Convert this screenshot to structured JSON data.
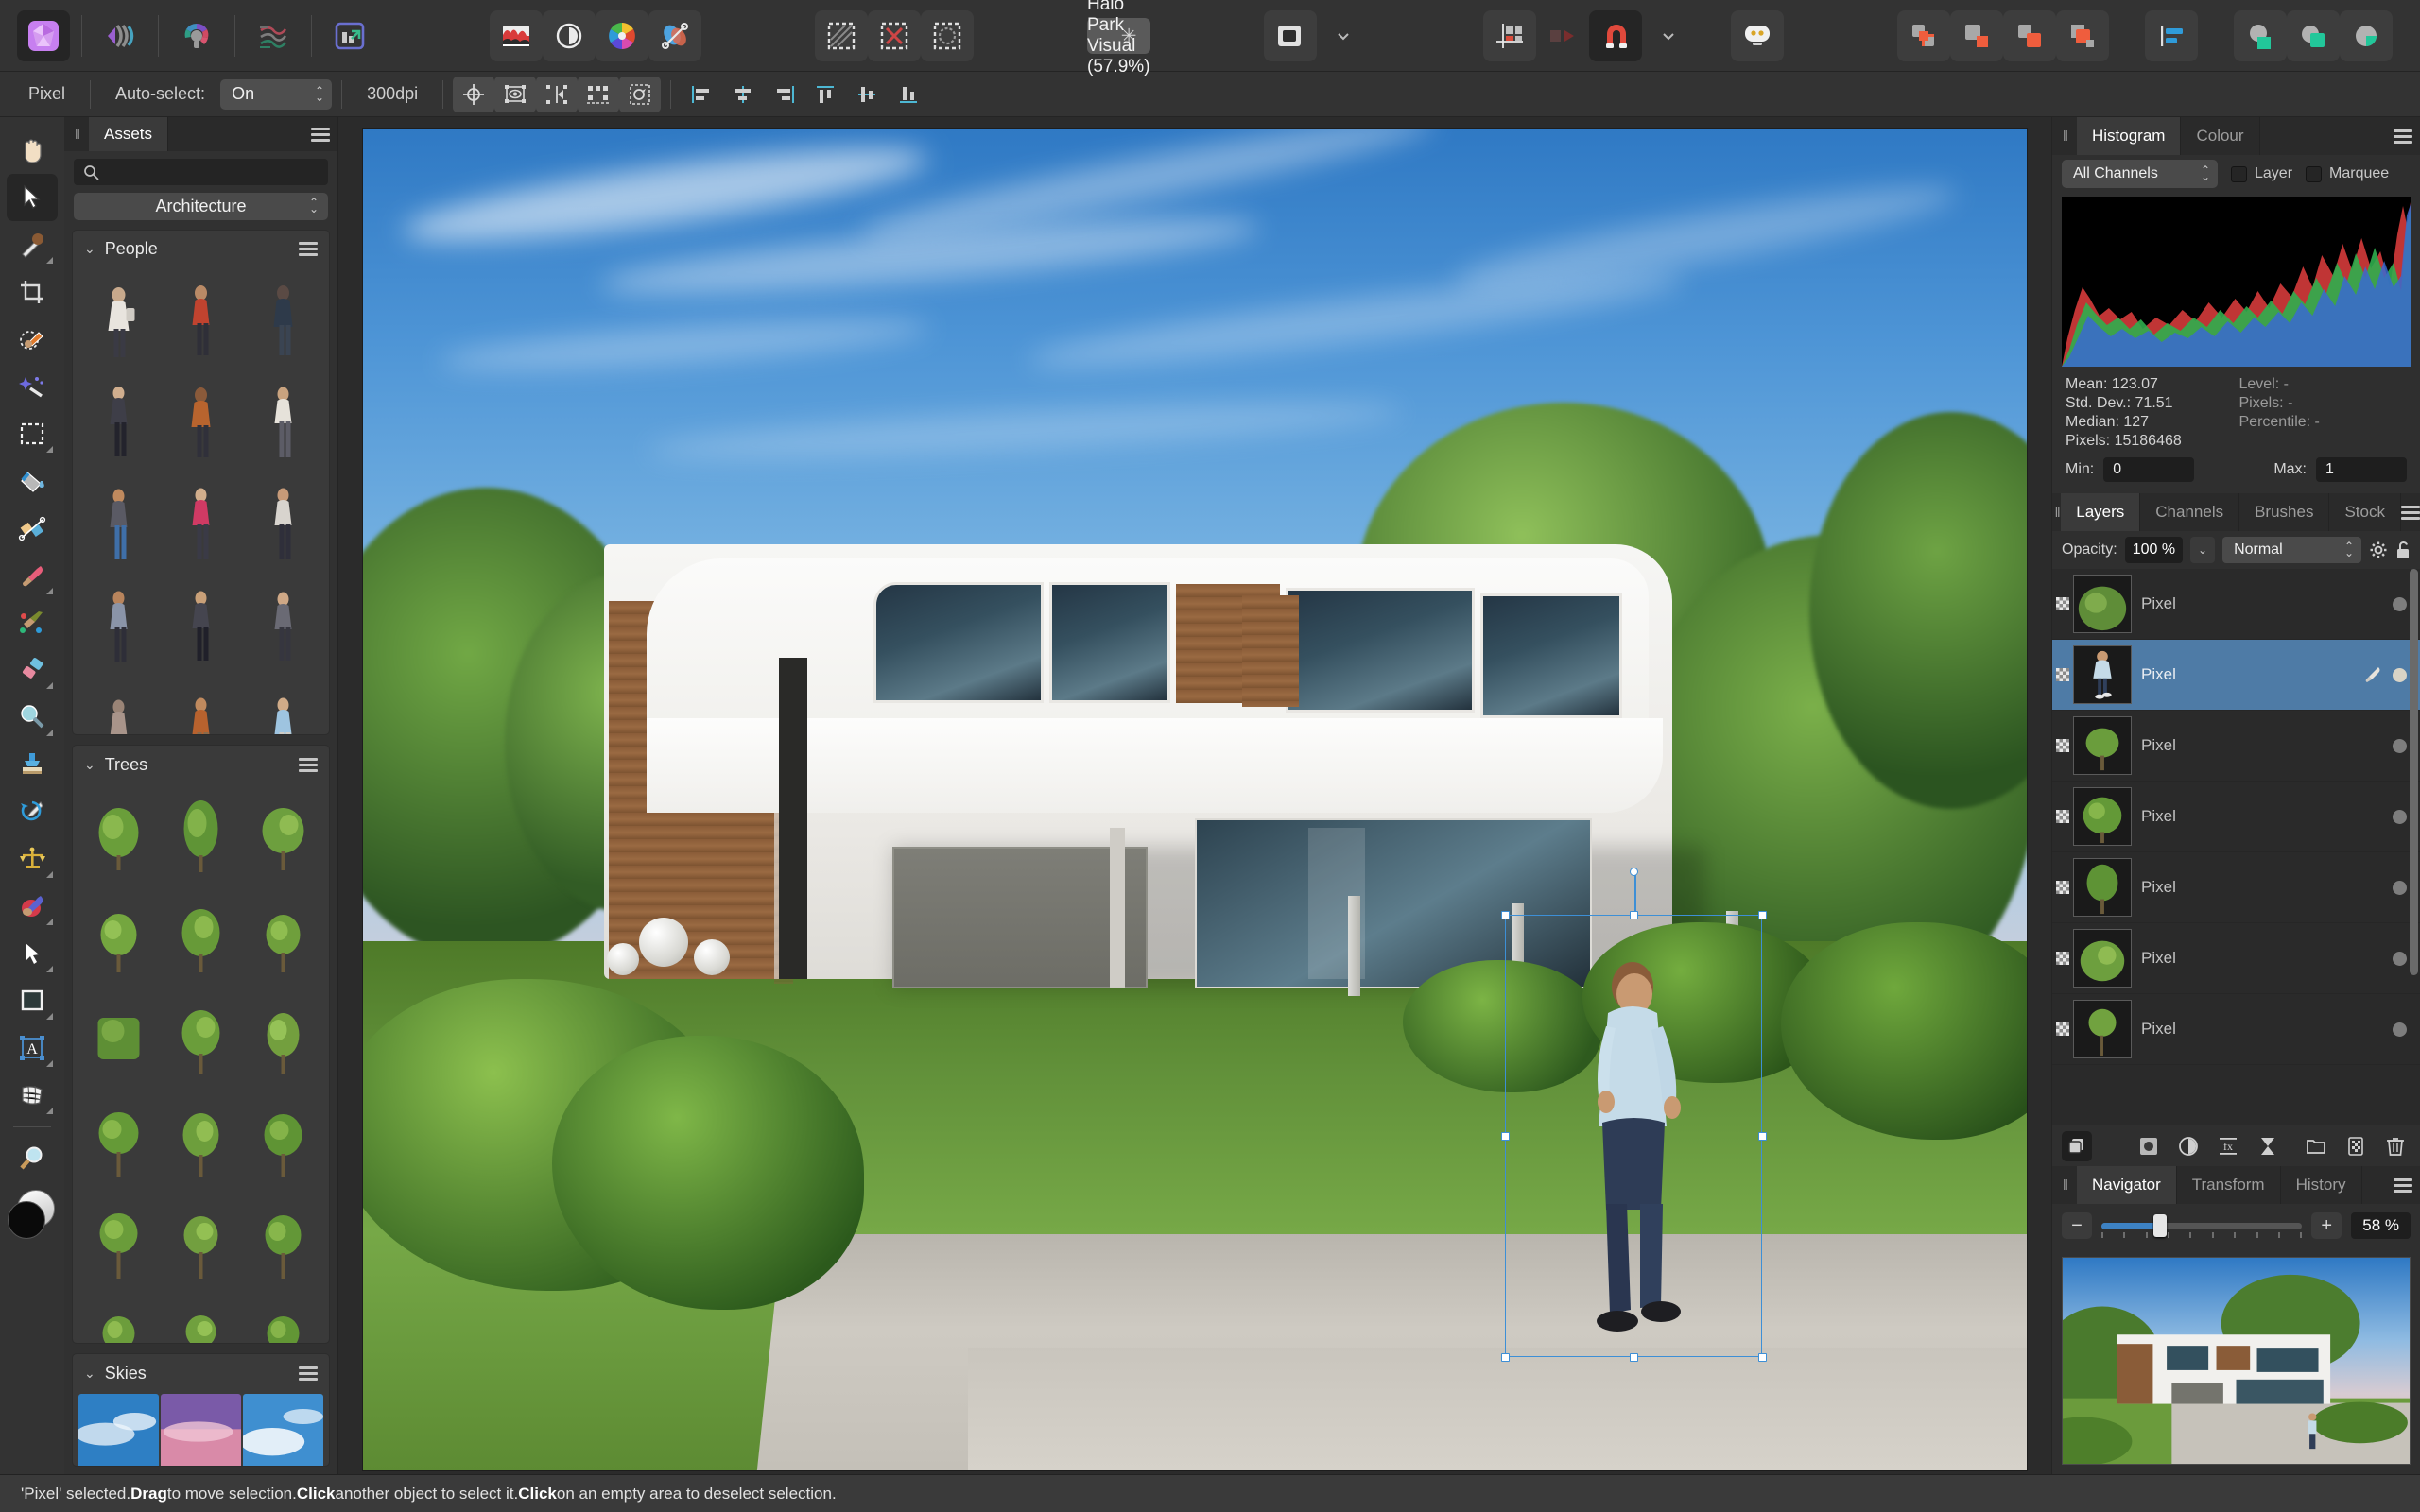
{
  "app": {
    "name": "Affinity Photo"
  },
  "topbar": {
    "document_title": "Halo Park Visual (57.9%)",
    "modified_marker": "✳",
    "persona_icons": [
      "photo-persona-icon",
      "liquify-persona-icon",
      "develop-persona-icon",
      "tone-mapping-persona-icon",
      "export-persona-icon"
    ],
    "adjustment_icons": [
      "histogram-icon",
      "adjustment-icon",
      "colour-wheel-icon",
      "live-filter-icon"
    ],
    "selection_icons": [
      "select-all-icon",
      "deselect-icon",
      "refine-selection-icon"
    ],
    "mask_icons": [
      "mask-icon",
      "mask-dropdown-icon"
    ],
    "assistant_icons": [
      "grid-icon",
      "screenshot-icon",
      "snapping-icon",
      "snapping-dropdown-icon",
      "assistant-icon"
    ],
    "boolean_icons": [
      "add-icon",
      "subtract-icon",
      "intersect-icon",
      "divide-icon"
    ],
    "arrange_icons": [
      "align-icon",
      "combine-icon",
      "merge-icon",
      "split-icon"
    ],
    "account_icon": "account-icon"
  },
  "context": {
    "mode_label": "Pixel",
    "auto_select_label": "Auto-select:",
    "auto_select_value": "On",
    "dpi_label": "300dpi",
    "transform_icons": [
      "move-origin-icon",
      "show-bounds-icon",
      "flip-horizontal-icon",
      "enable-transform-icon",
      "cycle-selection-icon"
    ],
    "align_icons": [
      "align-left-icon",
      "align-center-icon",
      "align-right-icon",
      "align-top-icon",
      "align-middle-icon",
      "align-bottom-icon"
    ]
  },
  "tools": {
    "items": [
      {
        "name": "view-tool",
        "icon": "hand-icon",
        "selected": false,
        "flyout": false
      },
      {
        "name": "move-tool",
        "icon": "cursor-arrow-icon",
        "selected": true,
        "flyout": false
      },
      {
        "name": "colour-picker-tool",
        "icon": "eyedropper-icon",
        "selected": false,
        "flyout": true
      },
      {
        "name": "crop-tool",
        "icon": "crop-icon",
        "selected": false,
        "flyout": false
      },
      {
        "name": "selection-brush",
        "icon": "selection-brush-icon",
        "selected": false,
        "flyout": false
      },
      {
        "name": "flood-select-tool",
        "icon": "magic-wand-icon",
        "selected": false,
        "flyout": false
      },
      {
        "name": "marquee-tool",
        "icon": "marquee-icon",
        "selected": false,
        "flyout": true
      },
      {
        "name": "flood-fill-tool",
        "icon": "paint-bucket-icon",
        "selected": false,
        "flyout": false
      },
      {
        "name": "gradient-tool",
        "icon": "gradient-icon",
        "selected": false,
        "flyout": false
      },
      {
        "name": "paint-brush-tool",
        "icon": "paintbrush-icon",
        "selected": false,
        "flyout": true
      },
      {
        "name": "paint-mixer-tool",
        "icon": "paint-mixer-icon",
        "selected": false,
        "flyout": false
      },
      {
        "name": "erase-brush-tool",
        "icon": "eraser-icon",
        "selected": false,
        "flyout": true
      },
      {
        "name": "blur-brush-tool",
        "icon": "blur-icon",
        "selected": false,
        "flyout": true
      },
      {
        "name": "clone-brush-tool",
        "icon": "clone-stamp-icon",
        "selected": false,
        "flyout": false
      },
      {
        "name": "undo-brush-tool",
        "icon": "undo-brush-icon",
        "selected": false,
        "flyout": false
      },
      {
        "name": "dodge-burn-tool",
        "icon": "balance-icon",
        "selected": false,
        "flyout": true
      },
      {
        "name": "inpainting-tool",
        "icon": "inpainting-icon",
        "selected": false,
        "flyout": true
      },
      {
        "name": "node-tool",
        "icon": "node-arrow-icon",
        "selected": false,
        "flyout": true
      },
      {
        "name": "rectangle-tool",
        "icon": "rectangle-icon",
        "selected": false,
        "flyout": true
      },
      {
        "name": "artistic-text-tool",
        "icon": "text-a-icon",
        "selected": false,
        "flyout": true
      },
      {
        "name": "mesh-warp-tool",
        "icon": "mesh-warp-icon",
        "selected": false,
        "flyout": true
      },
      {
        "name": "zoom-tool",
        "icon": "magnifier-icon",
        "selected": false,
        "flyout": false
      }
    ],
    "colour_swatch_name": "foreground-background-swatch"
  },
  "assets_panel": {
    "tabs": [
      {
        "label": "Assets",
        "active": true
      }
    ],
    "search_placeholder": "",
    "search_value": "",
    "category": "Architecture",
    "groups": [
      {
        "name": "People",
        "collapsed": false,
        "count": 15
      },
      {
        "name": "Trees",
        "collapsed": false,
        "count": 18
      },
      {
        "name": "Skies",
        "collapsed": false,
        "count": 3
      }
    ]
  },
  "canvas": {
    "document_name": "Halo Park Visual",
    "zoom_percent": "57.9%",
    "selection": {
      "label": "pixel-layer-selection",
      "handles": 8
    }
  },
  "histogram_panel": {
    "tabs": [
      {
        "label": "Histogram",
        "active": true
      },
      {
        "label": "Colour",
        "active": false
      }
    ],
    "channel_select": "All Channels",
    "checkboxes": [
      {
        "label": "Layer",
        "checked": false
      },
      {
        "label": "Marquee",
        "checked": false
      }
    ],
    "stats": [
      {
        "label": "Mean:",
        "value": "123.07"
      },
      {
        "label": "Std. Dev.:",
        "value": "71.51"
      },
      {
        "label": "Median:",
        "value": "127"
      },
      {
        "label": "Pixels:",
        "value": "15186468"
      }
    ],
    "stats_right": [
      {
        "label": "Level:",
        "value": "-"
      },
      {
        "label": "Pixels:",
        "value": "-"
      },
      {
        "label": "Percentile:",
        "value": "-"
      }
    ],
    "min_label": "Min:",
    "min_value": "0",
    "max_label": "Max:",
    "max_value": "1"
  },
  "layers_panel": {
    "tabs": [
      {
        "label": "Layers",
        "active": true
      },
      {
        "label": "Channels",
        "active": false
      },
      {
        "label": "Brushes",
        "active": false
      },
      {
        "label": "Stock",
        "active": false
      }
    ],
    "opacity_label": "Opacity:",
    "opacity_value": "100 %",
    "blend_mode": "Normal",
    "gear_icon": "settings-gear-icon",
    "lock_icon": "lock-open-icon",
    "rows": [
      {
        "name": "Pixel",
        "selected": false,
        "thumb": "tree-dark"
      },
      {
        "name": "Pixel",
        "selected": true,
        "thumb": "person"
      },
      {
        "name": "Pixel",
        "selected": false,
        "thumb": "tree-small"
      },
      {
        "name": "Pixel",
        "selected": false,
        "thumb": "tree-round"
      },
      {
        "name": "Pixel",
        "selected": false,
        "thumb": "tree-tall"
      },
      {
        "name": "Pixel",
        "selected": false,
        "thumb": "tree-bush"
      },
      {
        "name": "Pixel",
        "selected": false,
        "thumb": "tree-thin"
      }
    ],
    "actions": [
      "layer-modes-icon",
      "mask-layer-icon",
      "adjustment-layer-icon",
      "live-filter-layer-icon",
      "hourglass-icon",
      "add-group-icon",
      "add-pixel-layer-icon",
      "delete-layer-icon"
    ]
  },
  "navigator_panel": {
    "tabs": [
      {
        "label": "Navigator",
        "active": true
      },
      {
        "label": "Transform",
        "active": false
      },
      {
        "label": "History",
        "active": false
      }
    ],
    "zoom_out_label": "−",
    "zoom_in_label": "+",
    "zoom_value": "58 %"
  },
  "status_bar": {
    "parts": [
      {
        "text": "'Pixel' selected. ",
        "bold": false
      },
      {
        "text": "Drag",
        "bold": true
      },
      {
        "text": " to move selection. ",
        "bold": false
      },
      {
        "text": "Click",
        "bold": true
      },
      {
        "text": " another object to select it. ",
        "bold": false
      },
      {
        "text": "Click",
        "bold": true
      },
      {
        "text": " on an empty area to deselect selection.",
        "bold": false
      }
    ],
    "full_text": "'Pixel' selected. Drag to move selection. Click another object to select it. Click on an empty area to deselect selection."
  },
  "colors": {
    "accent_blue": "#3d82c4",
    "selection_blue": "#4e7ba6",
    "panel_bg": "#2f2f2f",
    "toolbar_bg": "#333333",
    "canvas_bg": "#2b2b2b"
  }
}
